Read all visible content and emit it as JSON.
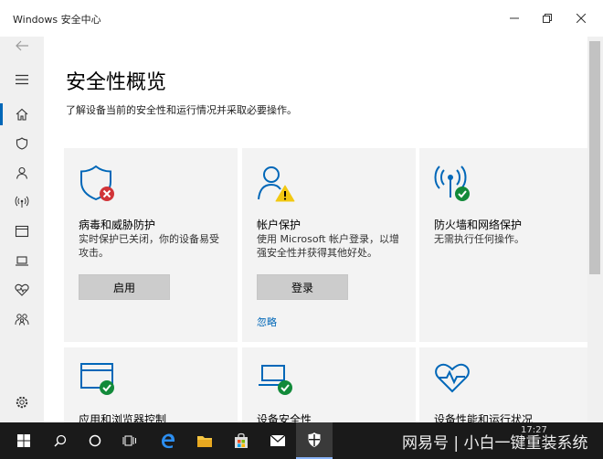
{
  "window": {
    "title": "Windows 安全中心"
  },
  "page": {
    "heading": "安全性概览",
    "subtitle": "了解设备当前的安全性和运行情况并采取必要操作。"
  },
  "cards": [
    {
      "title": "病毒和威胁防护",
      "desc": "实时保护已关闭，你的设备易受攻击。",
      "button": "启用"
    },
    {
      "title": "帐户保护",
      "desc": "使用 Microsoft 帐户登录，以增强安全性并获得其他好处。",
      "button": "登录",
      "link": "忽略"
    },
    {
      "title": "防火墙和网络保护",
      "desc": "无需执行任何操作。"
    },
    {
      "title": "应用和浏览器控制"
    },
    {
      "title": "设备安全性"
    },
    {
      "title": "设备性能和运行状况"
    }
  ],
  "taskbar": {
    "time": "17:27",
    "watermark": "网易号 | 小白一键重装系统"
  },
  "colors": {
    "accent": "#0067b8",
    "ok": "#128a3a",
    "error": "#d13438",
    "warn": "#f2c811"
  }
}
